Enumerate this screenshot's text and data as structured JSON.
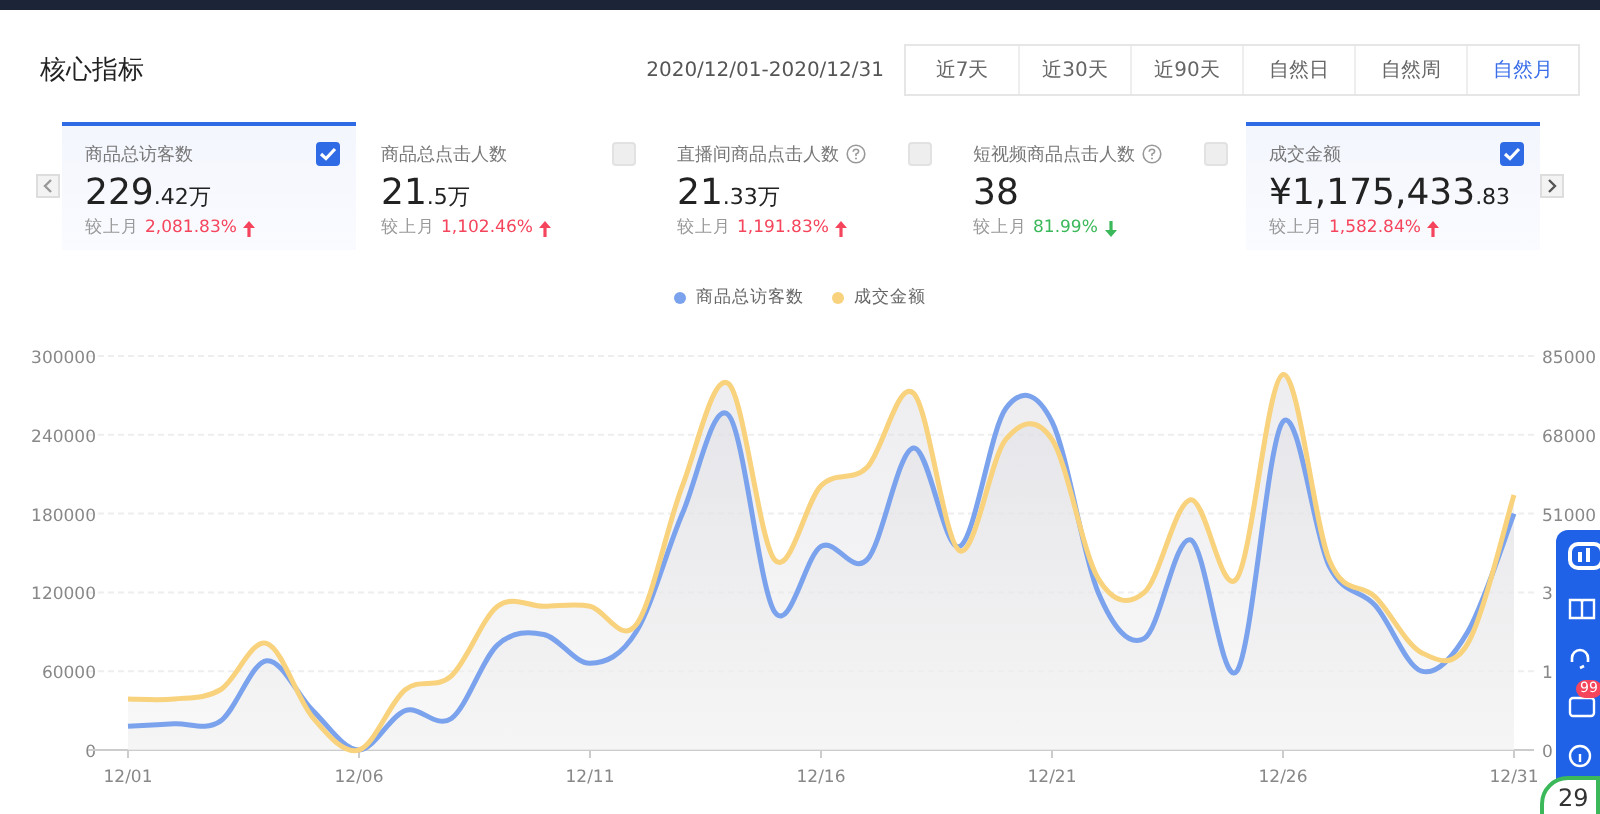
{
  "title": "核心指标",
  "date_range": "2020/12/01-2020/12/31",
  "periods": [
    {
      "label": "近7天",
      "selected": false
    },
    {
      "label": "近30天",
      "selected": false
    },
    {
      "label": "近90天",
      "selected": false
    },
    {
      "label": "自然日",
      "selected": false
    },
    {
      "label": "自然周",
      "selected": false
    },
    {
      "label": "自然月",
      "selected": true
    }
  ],
  "metrics": [
    {
      "label": "商品总访客数",
      "help": false,
      "checked": true,
      "value": "229",
      "value_small": ".42万",
      "compare_label": "较上月",
      "change": "2,081.83%",
      "increase": true
    },
    {
      "label": "商品总点击人数",
      "help": false,
      "checked": false,
      "value": "21",
      "value_small": ".5万",
      "compare_label": "较上月",
      "change": "1,102.46%",
      "increase": true
    },
    {
      "label": "直播间商品点击人数",
      "help": true,
      "checked": false,
      "value": "21",
      "value_small": ".33万",
      "compare_label": "较上月",
      "change": "1,191.83%",
      "increase": true
    },
    {
      "label": "短视频商品点击人数",
      "help": true,
      "checked": false,
      "value": "38",
      "compare_label": "较上月",
      "change": "81.99%",
      "increase": false
    },
    {
      "label": "成交金额",
      "help": false,
      "checked": true,
      "value": "¥1,175,433",
      "value_small": ".83",
      "compare_label": "较上月",
      "change": "1,582.84%",
      "increase": true
    }
  ],
  "chart_data": {
    "type": "area",
    "legend": "top",
    "grid": true,
    "categories": [
      "12/01",
      null,
      null,
      null,
      null,
      "12/06",
      null,
      null,
      null,
      null,
      "12/11",
      null,
      null,
      null,
      null,
      "12/16",
      null,
      null,
      null,
      null,
      "12/21",
      null,
      null,
      null,
      null,
      "12/26",
      null,
      null,
      null,
      null,
      "12/31"
    ],
    "yticks": [
      0,
      60000,
      120000,
      180000,
      240000,
      300000
    ],
    "ylim": [
      0,
      300000
    ],
    "y2ticks": [
      51000,
      68000,
      85000
    ],
    "y2lim": [
      0,
      85000
    ],
    "series": [
      {
        "name": "商品总访客数",
        "color": "#7ba2ec",
        "values": [
          18000,
          20000,
          22000,
          68000,
          30000,
          0,
          30000,
          24000,
          80000,
          88000,
          66000,
          90000,
          180000,
          255000,
          105000,
          155000,
          145000,
          230000,
          155000,
          260000,
          250000,
          120000,
          85000,
          160000,
          60000,
          250000,
          140000,
          110000,
          60000,
          90000,
          180000
        ]
      },
      {
        "name": "成交金额",
        "color": "#f8d27c",
        "axis": "y2",
        "values": [
          11000,
          11000,
          13000,
          23000,
          7000,
          0,
          13000,
          16000,
          31000,
          31000,
          31000,
          27000,
          57000,
          79000,
          41000,
          57000,
          61000,
          77000,
          43000,
          67000,
          67000,
          37000,
          34000,
          54000,
          37000,
          81000,
          41000,
          33000,
          21000,
          23000,
          55000
        ]
      }
    ]
  },
  "covered_axis_labels": [
    "3",
    "1",
    "0"
  ],
  "float_toolbar": {
    "badge": "99",
    "counter": "29"
  }
}
